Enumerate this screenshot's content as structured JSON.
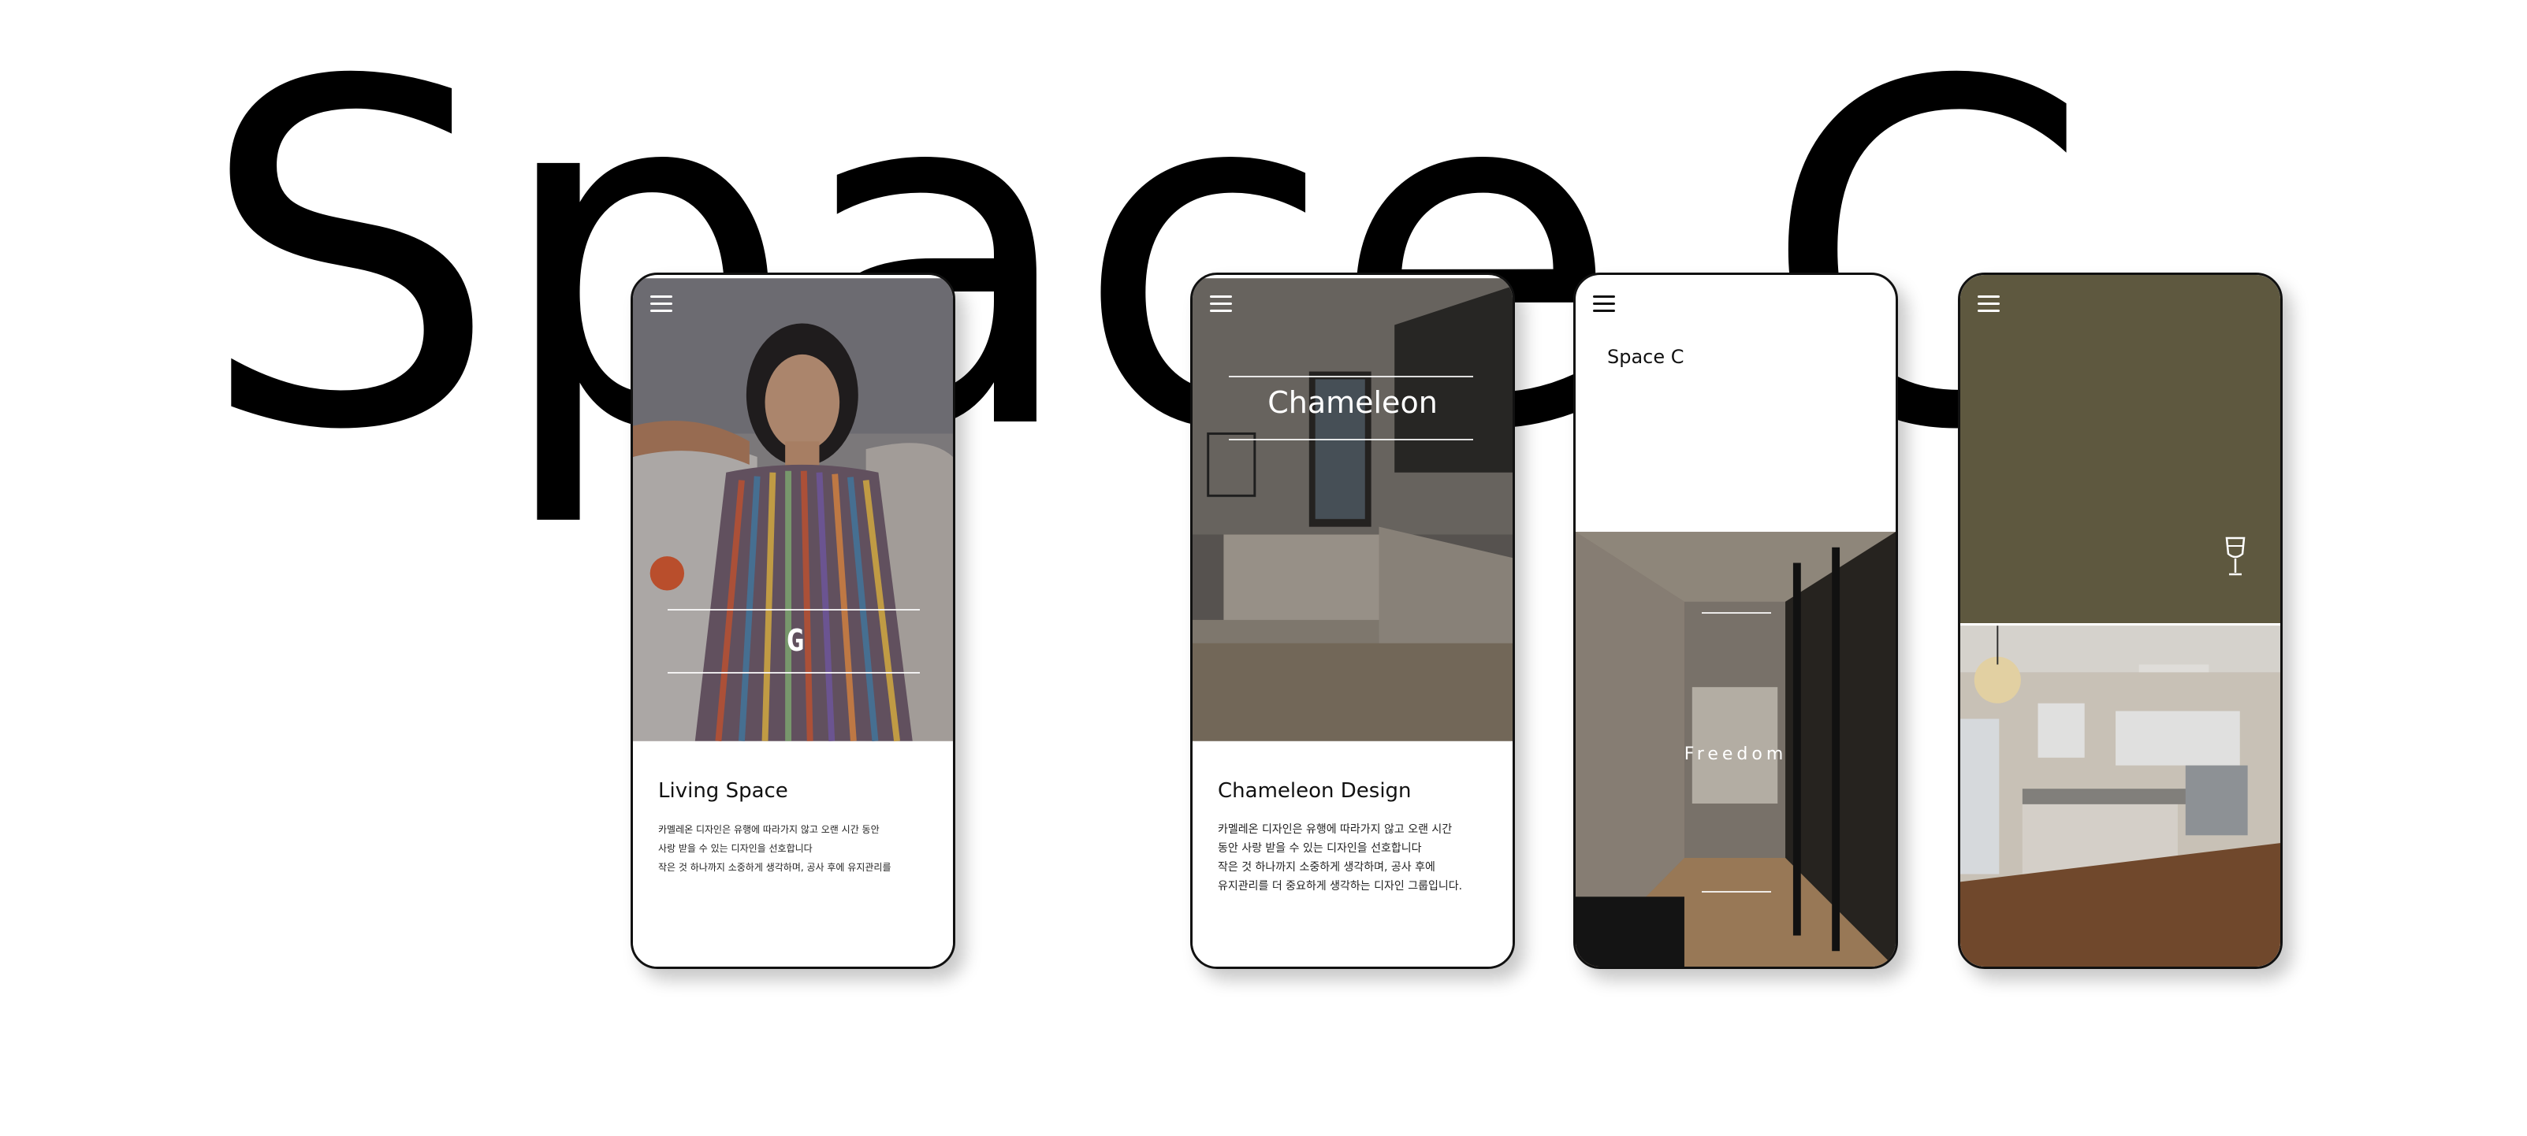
{
  "hero": {
    "title": "Space C"
  },
  "screens": [
    {
      "logo_glyph": "G",
      "caption_title": "Living Space",
      "caption_lines": [
        "카멜레온 디자인은 유행에 따라가지 않고 오랜 시간 동안",
        "사랑 받을 수 있는 디자인을 선호합니다",
        "작은 것 하나까지 소중하게 생각하며, 공사 후에 유지관리를"
      ]
    },
    {
      "overlay_title": "Chameleon",
      "caption_title": "Chameleon Design",
      "caption_lines": [
        "카멜레온 디자인은 유행에 따라가지 않고 오랜 시간",
        "동안 사랑 받을 수 있는 디자인을 선호합니다",
        "작은 것 하나까지 소중하게 생각하며, 공사 후에",
        "유지관리를 더 중요하게 생각하는 디자인 그룹입니다."
      ]
    },
    {
      "brand": "Space C",
      "overlay_text": "Freedom"
    },
    {
      "panel_color": "#5e583f",
      "icon": "wine-glass-icon"
    }
  ],
  "colors": {
    "olive": "#5e583f",
    "text": "#111111"
  }
}
